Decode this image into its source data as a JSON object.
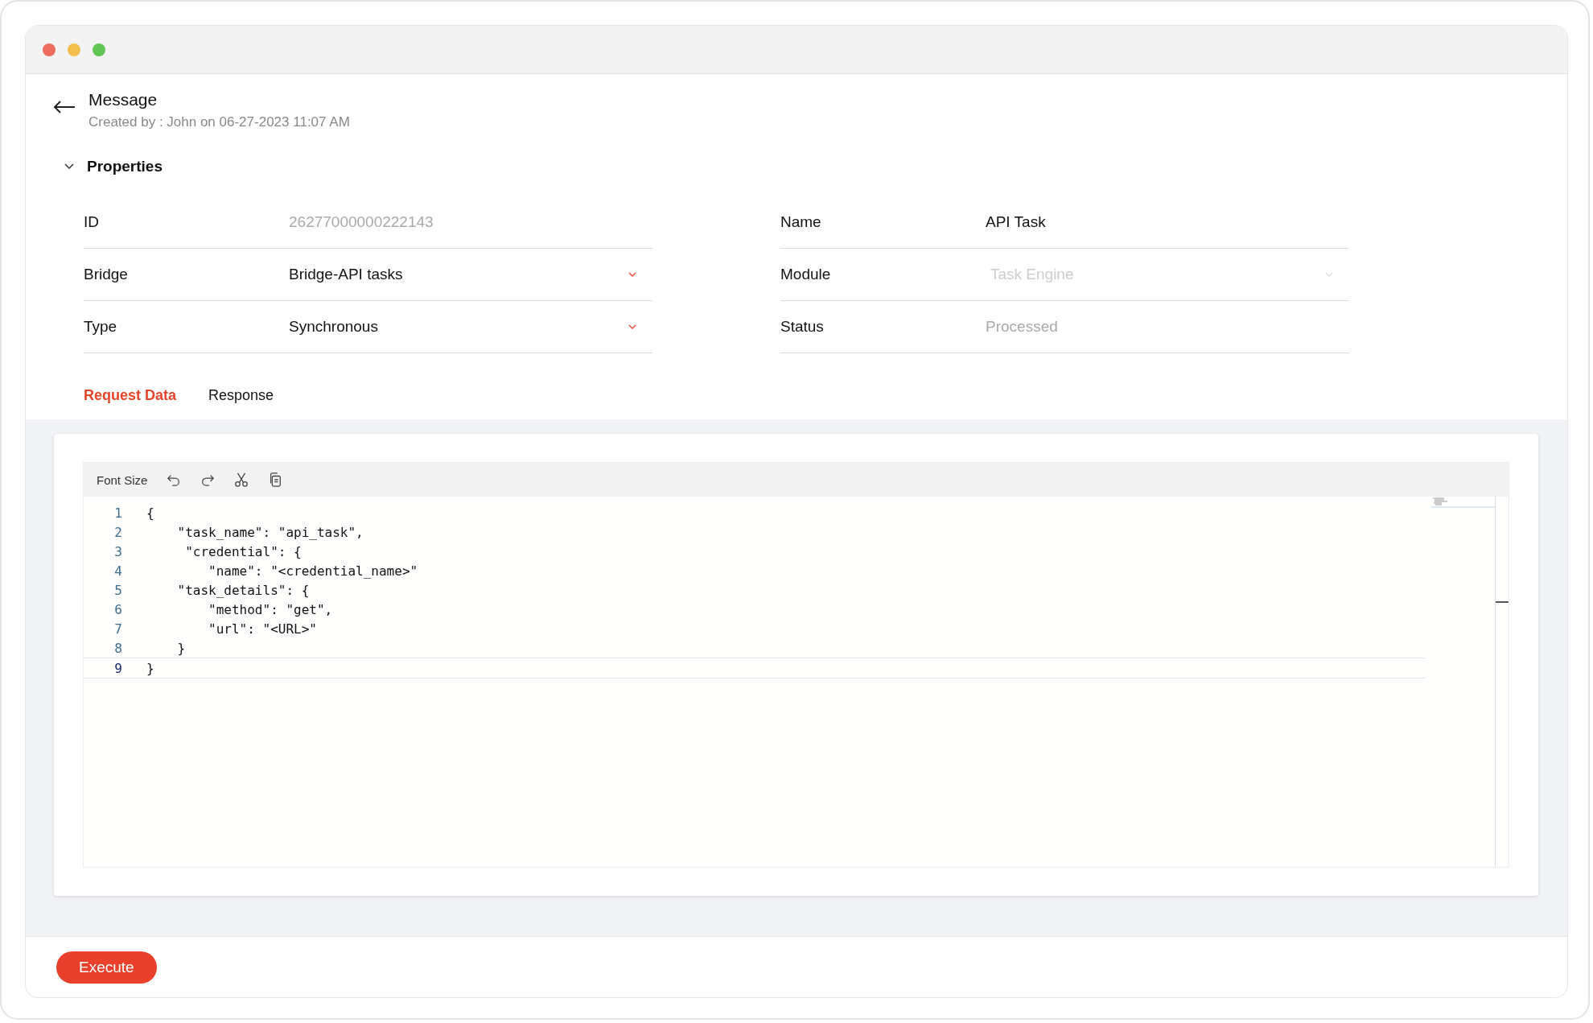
{
  "window": {
    "controls": [
      {
        "color": "#ec6b5e"
      },
      {
        "color": "#f4be4f"
      },
      {
        "color": "#61c554"
      }
    ]
  },
  "header": {
    "title": "Message",
    "subtitle": "Created by : John on 06-27-2023 11:07 AM"
  },
  "properties": {
    "title": "Properties",
    "expanded": true,
    "fields": [
      {
        "label": "ID",
        "value": "26277000000222143",
        "kind": "text",
        "disabled": true
      },
      {
        "label": "Name",
        "value": "API Task",
        "kind": "text",
        "disabled": false
      },
      {
        "label": "Bridge",
        "value": "Bridge-API tasks",
        "kind": "select",
        "disabled": false
      },
      {
        "label": "Module",
        "value": "Task Engine",
        "kind": "select",
        "disabled": true
      },
      {
        "label": "Type",
        "value": "Synchronous",
        "kind": "select",
        "disabled": false
      },
      {
        "label": "Status",
        "value": "Processed",
        "kind": "text",
        "disabled": true
      }
    ]
  },
  "tabs": [
    {
      "label": "Request Data",
      "selected": true
    },
    {
      "label": "Response",
      "selected": false
    }
  ],
  "editor": {
    "toolbar_label": "Font Size",
    "lines": [
      {
        "number": "1",
        "text": "{",
        "selected": false
      },
      {
        "number": "2",
        "text": "    \"task_name\": \"api_task\",",
        "selected": false
      },
      {
        "number": "3",
        "text": "     \"credential\": {",
        "selected": false
      },
      {
        "number": "4",
        "text": "        \"name\": \"<credential_name>\"",
        "selected": false
      },
      {
        "number": "5",
        "text": "    \"task_details\": {",
        "selected": false
      },
      {
        "number": "6",
        "text": "        \"method\": \"get\",",
        "selected": false
      },
      {
        "number": "7",
        "text": "        \"url\": \"<URL>\"",
        "selected": false
      },
      {
        "number": "8",
        "text": "    }",
        "selected": false
      },
      {
        "number": "9",
        "text": "}",
        "selected": true
      }
    ]
  },
  "footer": {
    "button": "Execute"
  }
}
